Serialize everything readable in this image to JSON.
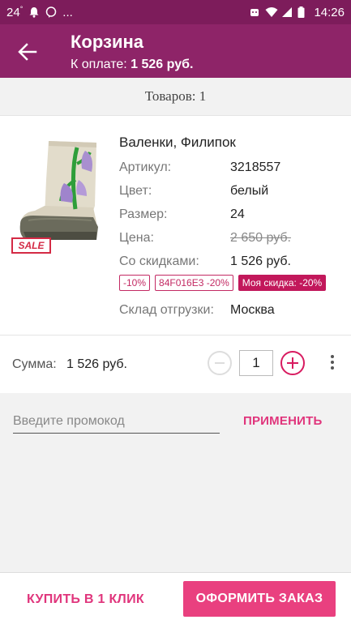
{
  "status_bar": {
    "temperature": "24",
    "temperature_unit": "°",
    "dots": "...",
    "time": "14:26"
  },
  "header": {
    "title": "Корзина",
    "subtitle_label": "К оплате:",
    "subtitle_value": "1 526 руб."
  },
  "items_count": "Товаров: 1",
  "product": {
    "name": "Валенки, Филипок",
    "sale_badge": "SALE",
    "attributes": [
      {
        "label": "Артикул:",
        "value": "3218557"
      },
      {
        "label": "Цвет:",
        "value": "белый"
      },
      {
        "label": "Размер:",
        "value": "24"
      },
      {
        "label": "Цена:",
        "value": "2 650 руб."
      },
      {
        "label": "Со скидками:",
        "value": "1 526 руб."
      }
    ],
    "discounts": [
      "-10%",
      "84F016E3 -20%",
      "Моя скидка: -20%"
    ],
    "warehouse_label": "Склад отгрузки:",
    "warehouse_value": "Москва"
  },
  "sum": {
    "label": "Сумма:",
    "value": "1 526 руб.",
    "quantity": "1"
  },
  "promo": {
    "placeholder": "Введите промокод",
    "apply_label": "ПРИМЕНИТЬ"
  },
  "bottom": {
    "buy_one_click": "КУПИТЬ В 1 КЛИК",
    "checkout": "ОФОРМИТЬ ЗАКАЗ"
  },
  "colors": {
    "status_bar": "#7d1c5b",
    "app_bar": "#8e2468",
    "accent": "#e9407f"
  }
}
